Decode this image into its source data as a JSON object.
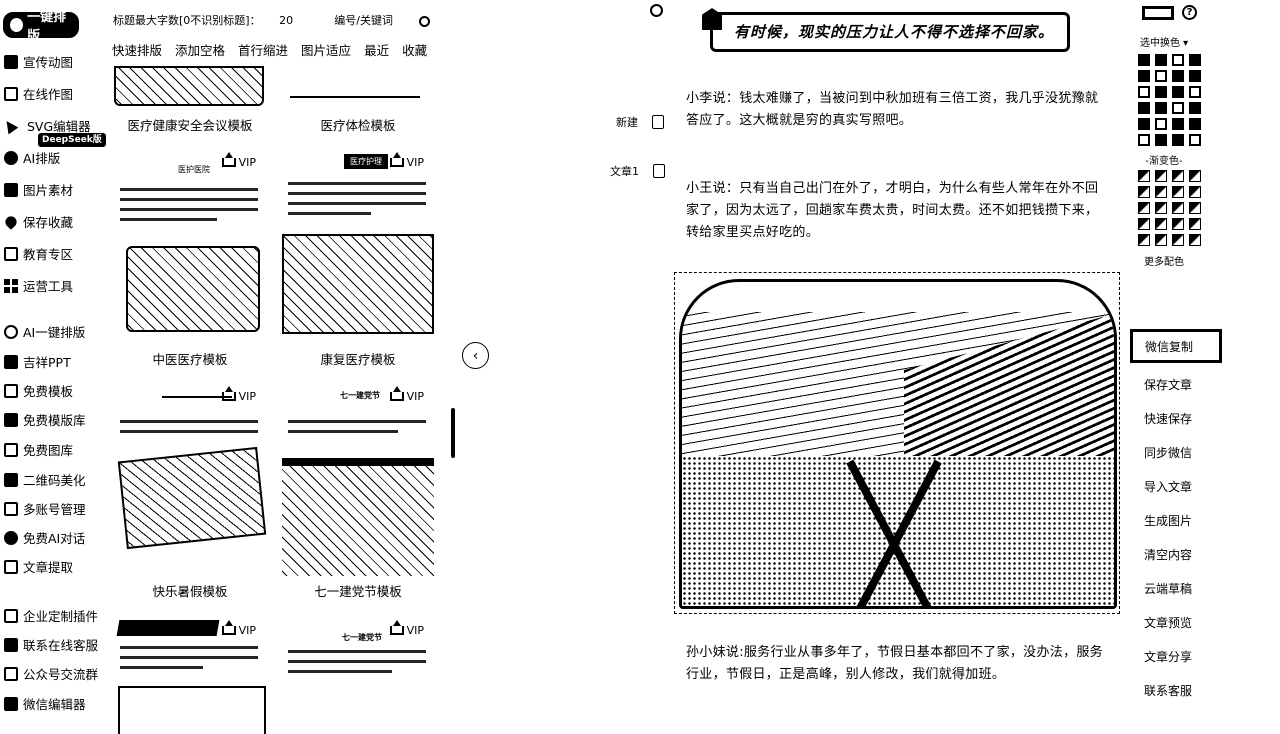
{
  "sidebar": {
    "logo_label": "一键排版",
    "items": [
      {
        "label": "宣传动图",
        "icon": "gif-icon"
      },
      {
        "label": "在线作图",
        "icon": "pen-icon"
      },
      {
        "label": "SVG编辑器",
        "icon": "cursor-icon"
      },
      {
        "label": "AI排版",
        "icon": "ai-icon"
      },
      {
        "label": "图片素材",
        "icon": "image-icon"
      },
      {
        "label": "保存收藏",
        "icon": "heart-icon"
      },
      {
        "label": "教育专区",
        "icon": "book-icon"
      },
      {
        "label": "运营工具",
        "icon": "grid-icon"
      },
      {
        "label": "AI一键排版",
        "icon": "ai-layout-icon"
      },
      {
        "label": "吉祥PPT",
        "icon": "ppt-icon"
      },
      {
        "label": "免费模板",
        "icon": "template-icon"
      },
      {
        "label": "免费模版库",
        "icon": "library-icon"
      },
      {
        "label": "免费图库",
        "icon": "gallery-icon"
      },
      {
        "label": "二维码美化",
        "icon": "qrcode-icon"
      },
      {
        "label": "多账号管理",
        "icon": "account-icon"
      },
      {
        "label": "免费AI对话",
        "icon": "chat-icon"
      },
      {
        "label": "文章提取",
        "icon": "extract-icon"
      },
      {
        "label": "企业定制插件",
        "icon": "plugin-icon"
      },
      {
        "label": "联系在线客服",
        "icon": "service-icon"
      },
      {
        "label": "公众号交流群",
        "icon": "group-icon"
      },
      {
        "label": "微信编辑器",
        "icon": "wechat-icon"
      }
    ],
    "deepseek_badge": "DeepSeek版"
  },
  "templates": {
    "title_limit_label": "标题最大字数[0不识别标题]：",
    "title_limit_value": "20",
    "search_placeholder": "编号/关键词",
    "tabs": [
      "快速排版",
      "添加空格",
      "首行缩进",
      "图片适应",
      "最近",
      "收藏"
    ],
    "vip_label": "VIP",
    "cards": [
      {
        "name": "医疗健康安全会议模板",
        "vip": false
      },
      {
        "name": "医疗体检模板",
        "vip": false
      },
      {
        "name": "中医医疗模板",
        "vip": true,
        "mini_title": "医护医院"
      },
      {
        "name": "康复医疗模板",
        "vip": true,
        "mini_title": "医疗护理"
      },
      {
        "name": "快乐暑假模板",
        "vip": true
      },
      {
        "name": "七一建党节模板",
        "vip": true,
        "mini_title": "七一建党节"
      },
      {
        "name": "",
        "vip": true,
        "mini_title": "七一建党节"
      },
      {
        "name": "",
        "vip": true,
        "mini_title": "七一建党节"
      }
    ]
  },
  "article_tools": {
    "new_label": "新建",
    "article_label": "文章1"
  },
  "editor": {
    "banner_text": "有时候，现实的压力让人不得不选择不回家。",
    "paragraphs": [
      "小李说：钱太难赚了，当被问到中秋加班有三倍工资，我几乎没犹豫就答应了。这大概就是穷的真实写照吧。",
      "小王说：只有当自己出门在外了，才明白，为什么有些人常年在外不回家了，因为太远了，回趟家车费太贵，时间太费。还不如把钱攒下来，转给家里买点好吃的。",
      "孙小妹说:服务行业从事多年了，节假日基本都回不了家，没办法，服务行业，节假日，正是高峰，别人修改，我们就得加班。"
    ]
  },
  "color_panel": {
    "select_color_label": "选中换色",
    "gradient_label": "-渐变色-",
    "more_label": "更多配色"
  },
  "right_toolbar": {
    "items": [
      "微信复制",
      "保存文章",
      "快速保存",
      "同步微信",
      "导入文章",
      "生成图片",
      "清空内容",
      "云端草稿",
      "文章预览",
      "文章分享",
      "联系客服"
    ]
  }
}
